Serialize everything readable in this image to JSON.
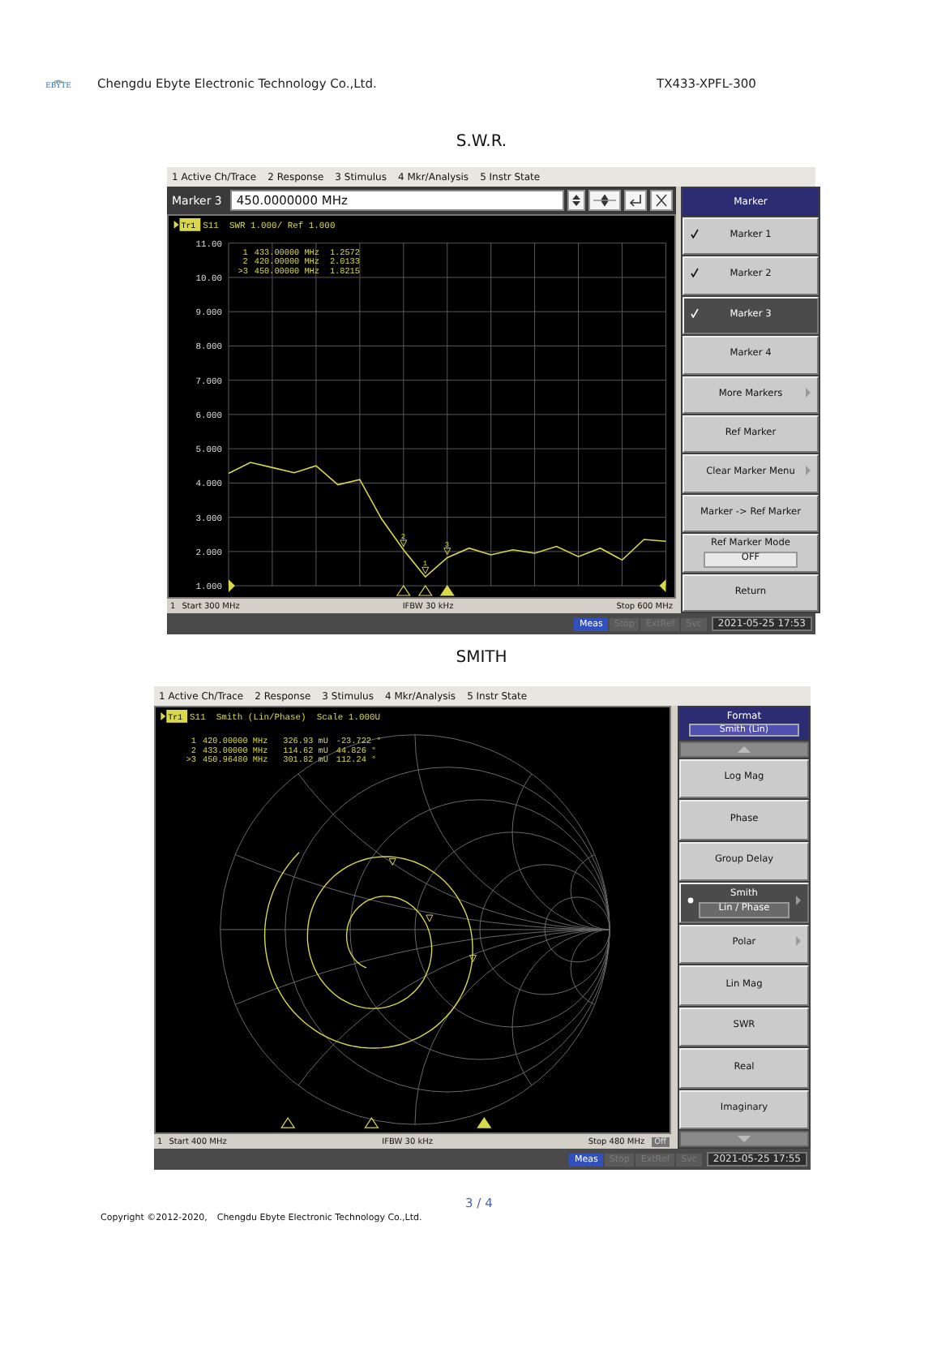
{
  "header": {
    "logo_text": "EBYTE",
    "company": "Chengdu Ebyte Electronic Technology Co.,Ltd.",
    "model": "TX433-XPFL-300"
  },
  "sections": [
    {
      "title": "S.W.R.",
      "analyzer": {
        "kind": "swr",
        "menu": [
          "1 Active Ch/Trace",
          "2 Response",
          "3 Stimulus",
          "4 Mkr/Analysis",
          "5 Instr State"
        ],
        "entry": {
          "label": "Marker 3",
          "value": "450.0000000 MHz"
        },
        "trace": {
          "tag": "Tr1",
          "header": "S11  SWR 1.000/ Ref 1.000"
        },
        "markers": [
          {
            "label": "1",
            "freq": "433.00000 MHz",
            "value": "1.2572",
            "selected": false
          },
          {
            "label": "2",
            "freq": "420.00000 MHz",
            "value": "2.0133",
            "selected": false
          },
          {
            "label": ">3",
            "freq": "450.00000 MHz",
            "value": "1.8215",
            "selected": true
          }
        ],
        "trace_labels": [
          "1",
          "2",
          "3"
        ],
        "chart_data": {
          "type": "line",
          "categories": [
            null,
            null,
            null,
            null,
            null,
            null,
            null,
            null,
            null,
            null,
            null,
            null,
            null,
            null,
            null,
            null,
            null,
            null,
            null,
            null,
            null
          ],
          "series": [
            {
              "color": "#d8d84a",
              "values": [
                4.28,
                4.6,
                4.45,
                4.3,
                4.5,
                3.95,
                4.1,
                2.95,
                2.05,
                1.26,
                1.82,
                2.1,
                1.9,
                2.05,
                1.95,
                2.15,
                1.85,
                2.1,
                1.75,
                2.35,
                2.3
              ]
            }
          ],
          "ylim": [
            1,
            11
          ],
          "grid": true,
          "yticks": [
            {
              "value": 1,
              "label": "1.000"
            },
            {
              "value": 2,
              "label": "2.000"
            },
            {
              "value": 3,
              "label": "3.000"
            },
            {
              "value": 4,
              "label": "4.000"
            },
            {
              "value": 5,
              "label": "5.000"
            },
            {
              "value": 6,
              "label": "6.000"
            },
            {
              "value": 7,
              "label": "7.000"
            },
            {
              "value": 8,
              "label": "8.000"
            },
            {
              "value": 9,
              "label": "9.000"
            },
            {
              "value": 10,
              "label": "10.00"
            },
            {
              "value": 11,
              "label": "11.00"
            }
          ]
        },
        "status": {
          "channel": "1",
          "start": "Start 300 MHz",
          "center": "IFBW 30 kHz",
          "stop": "Stop 600 MHz"
        },
        "softkeys": [
          {
            "kind": "title",
            "label": "Marker"
          },
          {
            "kind": "key",
            "label": "Marker 1",
            "checked": true,
            "selected": false,
            "submenu": false
          },
          {
            "kind": "key",
            "label": "Marker 2",
            "checked": true,
            "selected": false,
            "submenu": false
          },
          {
            "kind": "key",
            "label": "Marker 3",
            "checked": true,
            "selected": true,
            "submenu": false
          },
          {
            "kind": "key",
            "label": "Marker 4",
            "checked": false,
            "selected": false,
            "submenu": false
          },
          {
            "kind": "key",
            "label": "More Markers",
            "checked": false,
            "selected": false,
            "submenu": true
          },
          {
            "kind": "key",
            "label": "Ref Marker",
            "checked": false,
            "selected": false,
            "submenu": false
          },
          {
            "kind": "key",
            "label": "Clear Marker Menu",
            "checked": false,
            "selected": false,
            "submenu": true
          },
          {
            "kind": "key",
            "label": "Marker -> Ref Marker",
            "checked": false,
            "selected": false,
            "submenu": false
          },
          {
            "kind": "value",
            "label": "Ref Marker Mode",
            "value": "OFF",
            "checked": false,
            "selected": false,
            "submenu": false
          },
          {
            "kind": "key",
            "label": "Return",
            "checked": false,
            "selected": false,
            "submenu": false
          }
        ],
        "bottom_bar": {
          "buttons": [
            {
              "label": "Meas",
              "selected": true
            },
            {
              "label": "Stop",
              "selected": false
            },
            {
              "label": "ExtRef",
              "selected": false
            },
            {
              "label": "Svc",
              "selected": false
            }
          ],
          "time": "2021-05-25 17:53"
        }
      }
    },
    {
      "title": "SMITH",
      "analyzer": {
        "kind": "smith",
        "menu": [
          "1 Active Ch/Trace",
          "2 Response",
          "3 Stimulus",
          "4 Mkr/Analysis",
          "5 Instr State"
        ],
        "trace": {
          "tag": "Tr1",
          "header": "S11  Smith (Lin/Phase)  Scale 1.000U"
        },
        "markers": [
          {
            "label": "1",
            "freq": "420.00000 MHz",
            "value": "326.93 mU",
            "phase": "-23.722 °",
            "selected": false
          },
          {
            "label": "2",
            "freq": "433.00000 MHz",
            "value": "114.62 mU",
            "phase": "44.826 °",
            "selected": false
          },
          {
            "label": ">3",
            "freq": "450.96480 MHz",
            "value": "301.82 mU",
            "phase": "112.24 °",
            "selected": true
          }
        ],
        "status": {
          "channel": "1",
          "start": "Start 400 MHz",
          "center": "IFBW 30 kHz",
          "stop": "Stop 480 MHz",
          "badge": "Off"
        },
        "softkeys": [
          {
            "kind": "title",
            "label": "Format",
            "value": "Smith (Lin)"
          },
          {
            "kind": "scroll_up"
          },
          {
            "kind": "key",
            "label": "Log Mag",
            "checked": false,
            "selected": false,
            "submenu": false
          },
          {
            "kind": "key",
            "label": "Phase",
            "checked": false,
            "selected": false,
            "submenu": false
          },
          {
            "kind": "key",
            "label": "Group Delay",
            "checked": false,
            "selected": false,
            "submenu": false
          },
          {
            "kind": "value",
            "label": "Smith",
            "value": "Lin / Phase",
            "checked": true,
            "selected": true,
            "submenu": true
          },
          {
            "kind": "key",
            "label": "Polar",
            "checked": false,
            "selected": false,
            "submenu": true
          },
          {
            "kind": "key",
            "label": "Lin Mag",
            "checked": false,
            "selected": false,
            "submenu": false
          },
          {
            "kind": "key",
            "label": "SWR",
            "checked": false,
            "selected": false,
            "submenu": false
          },
          {
            "kind": "key",
            "label": "Real",
            "checked": false,
            "selected": false,
            "submenu": false
          },
          {
            "kind": "key",
            "label": "Imaginary",
            "checked": false,
            "selected": false,
            "submenu": false
          },
          {
            "kind": "scroll_down"
          }
        ],
        "bottom_bar": {
          "buttons": [
            {
              "label": "Meas",
              "selected": true
            },
            {
              "label": "Stop",
              "selected": false
            },
            {
              "label": "ExtRef",
              "selected": false
            },
            {
              "label": "Svc",
              "selected": false
            }
          ],
          "time": "2021-05-25 17:55"
        }
      }
    }
  ],
  "footer": {
    "page": "3 / 4",
    "copyright": "Copyright ©2012-2020,",
    "company": "Chengdu Ebyte Electronic Technology Co.,Ltd."
  }
}
